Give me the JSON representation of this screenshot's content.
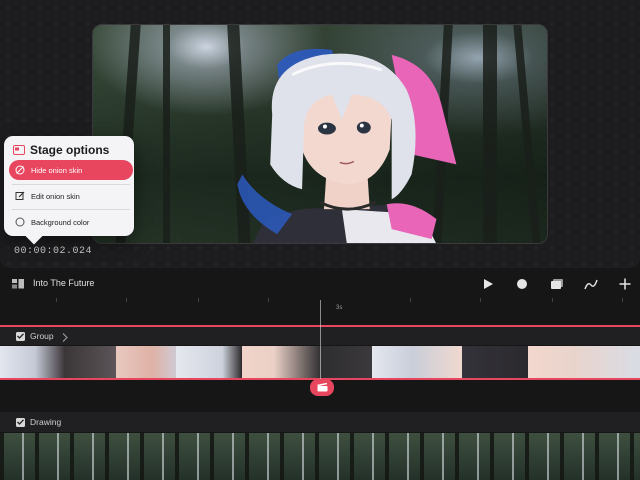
{
  "stage": {
    "timestamp": "00:00:02.024"
  },
  "stage_options": {
    "title": "Stage options",
    "items": [
      {
        "label": "Hide onion skin",
        "icon": "onion-skin-icon",
        "active": true
      },
      {
        "label": "Edit onion skin",
        "icon": "edit-icon",
        "active": false
      },
      {
        "label": "Background color",
        "icon": "color-circle-icon",
        "active": false
      }
    ]
  },
  "timeline": {
    "project_title": "Into The Future",
    "ruler_label": "3s",
    "tools": [
      "play-icon",
      "record-icon",
      "layers-icon",
      "brush-icon",
      "add-icon"
    ],
    "layers": [
      {
        "name": "Group",
        "expandable": true
      },
      {
        "name": "Drawing",
        "expandable": false
      }
    ]
  },
  "colors": {
    "accent": "#e8455f",
    "background": "#161616",
    "panel": "#1d1d1f"
  }
}
